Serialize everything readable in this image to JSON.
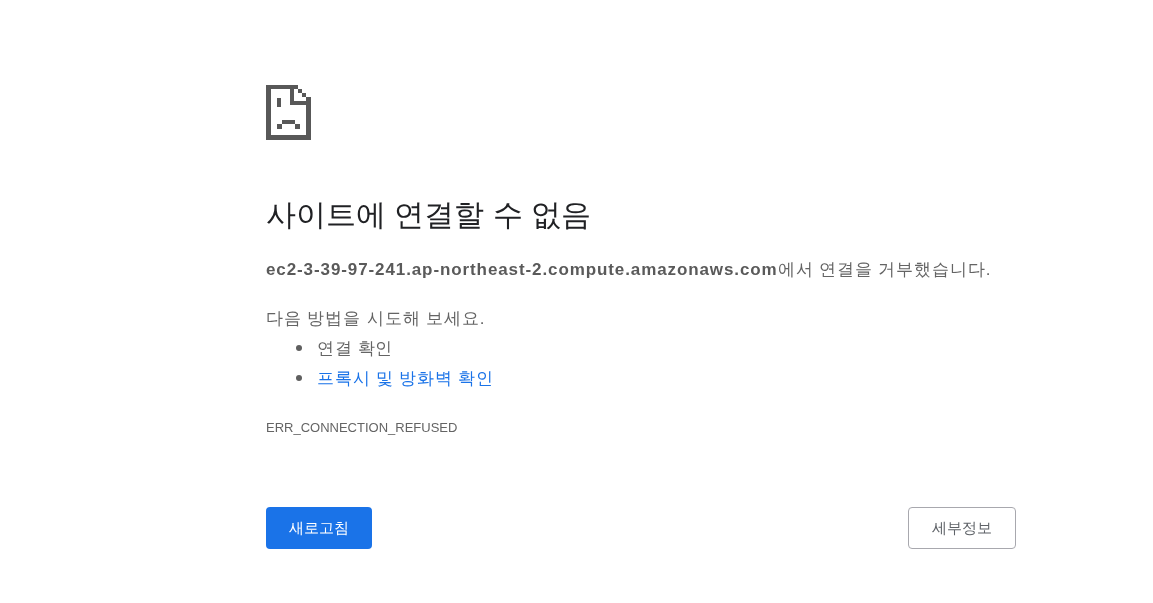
{
  "heading": "사이트에 연결할 수 없음",
  "message": "**ec2-3-39-97-241.ap-northeast-2.compute.amazonaws.com**에서 연결을 거부했습니다.",
  "suggestions": {
    "intro": "다음 방법을 시도해 보세요.",
    "items": [
      {
        "kind": "text",
        "text": "연결 확인"
      },
      {
        "kind": "link",
        "text": "프록시 및 방화벽 확인"
      }
    ]
  },
  "error_code": "ERR_CONNECTION_REFUSED",
  "buttons": [
    {
      "kind": "primary",
      "label": "새로고침"
    },
    {
      "kind": "secondary",
      "label": "세부정보"
    }
  ]
}
